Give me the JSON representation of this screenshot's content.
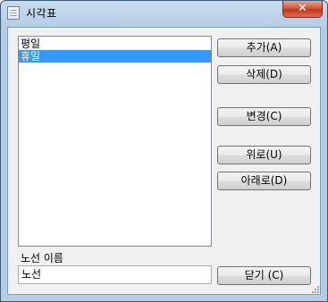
{
  "window": {
    "title": "시각표",
    "close_glyph": "✕"
  },
  "list": {
    "items": [
      {
        "label": "평일",
        "selected": false
      },
      {
        "label": "휴일",
        "selected": true
      }
    ]
  },
  "buttons": {
    "add": "추가(A)",
    "delete": "삭제(D)",
    "change": "변경(C)",
    "up": "위로(U)",
    "down": "아래로(D)",
    "close": "닫기 (C)"
  },
  "route_name": {
    "label": "노선 이름",
    "value": "노선"
  },
  "colors": {
    "selection": "#3399ff",
    "close_button": "#c2361a"
  },
  "icons": [
    "window-icon",
    "close-icon",
    "resize-grip-icon"
  ]
}
